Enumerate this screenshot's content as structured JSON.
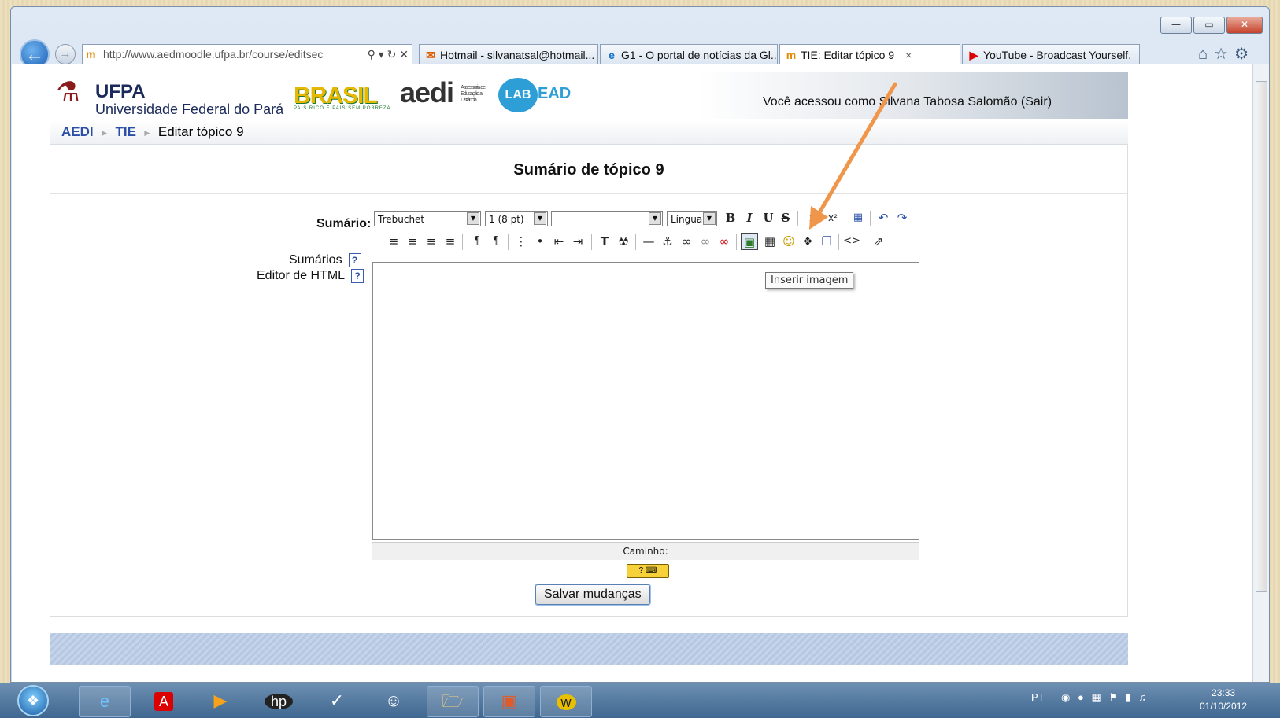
{
  "window": {
    "caption_buttons": [
      "—",
      "▭",
      "✕"
    ]
  },
  "browser": {
    "address": "http://www.aedmoodle.ufpa.br/course/editsec",
    "tabs": [
      {
        "label": "Hotmail - silvanatsal@hotmail...",
        "icon": "✉"
      },
      {
        "label": "G1 - O portal de notícias da Gl...",
        "icon": "e"
      },
      {
        "label": "TIE: Editar tópico 9",
        "icon": "m"
      },
      {
        "label": "YouTube - Broadcast Yourself.",
        "icon": "▶"
      }
    ],
    "close_tab": "×"
  },
  "header": {
    "ufpa_title": "UFPA",
    "ufpa_subtitle": "Universidade Federal do Pará",
    "brasil": "BRASIL",
    "brasil_tagline": "PAÍS RICO É PAÍS SEM POBREZA",
    "aedi": "aedi",
    "aedi_tag": "Assessoria de Educação a Distância",
    "labead_a": "LAB",
    "labead_b": "EAD",
    "login_text": "Você acessou como Silvana Tabosa Salomão (Sair)"
  },
  "breadcrumb": {
    "items": [
      "AEDI",
      "TIE"
    ],
    "current": "Editar tópico 9"
  },
  "main": {
    "title": "Sumário de tópico 9",
    "summary_label": "Sumário:",
    "help_links": [
      "Sumários",
      "Editor de HTML"
    ],
    "help_glyph": "?"
  },
  "editor": {
    "font": "Trebuchet",
    "size": "1 (8 pt)",
    "style": "",
    "language": "Língua",
    "tooltip": "Inserir imagem",
    "path_label": "Caminho:",
    "kbd_label": "?"
  },
  "actions": {
    "save": "Salvar mudanças"
  },
  "taskbar": {
    "lang": "PT",
    "time": "23:33",
    "date": "01/10/2012"
  },
  "colors": {
    "accent_arrow": "#f0964a",
    "link": "#2a4fa8"
  }
}
